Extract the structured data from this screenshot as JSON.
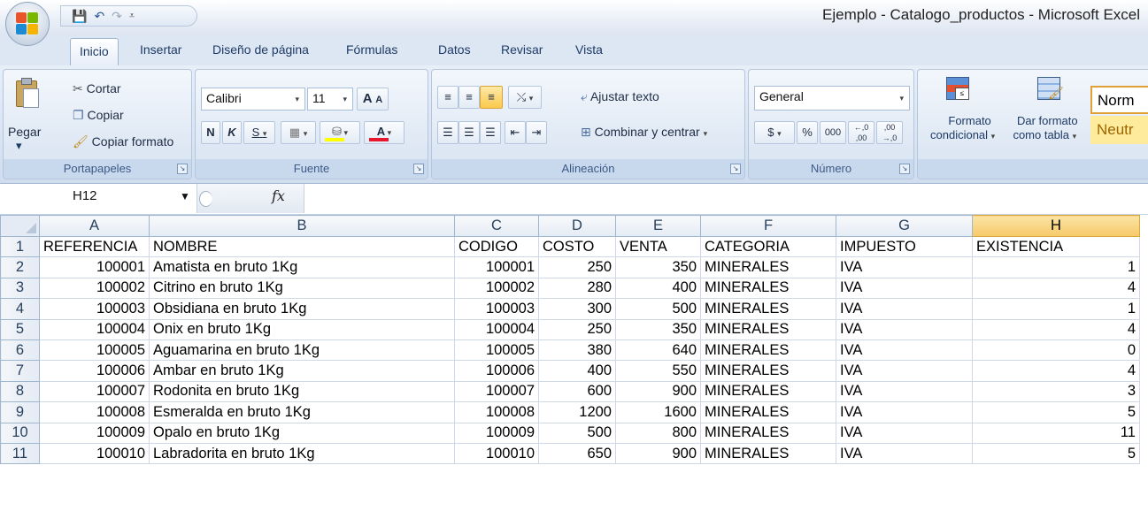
{
  "window": {
    "title": "Ejemplo - Catalogo_productos - Microsoft Excel",
    "quick_access": {
      "save": "💾",
      "undo": "↶",
      "redo": "↷",
      "customize": "⩡"
    }
  },
  "tabs": [
    "Inicio",
    "Insertar",
    "Diseño de página",
    "Fórmulas",
    "Datos",
    "Revisar",
    "Vista"
  ],
  "active_tab": "Inicio",
  "ribbon": {
    "clipboard": {
      "label": "Portapapeles",
      "paste": "Pegar",
      "cut": "Cortar",
      "copy": "Copiar",
      "format_painter": "Copiar formato"
    },
    "font": {
      "label": "Fuente",
      "font_name": "Calibri",
      "font_size": "11",
      "grow": "A",
      "shrink": "A",
      "bold": "N",
      "italic": "K",
      "underline": "S",
      "font_color": "A"
    },
    "alignment": {
      "label": "Alineación",
      "wrap_text": "Ajustar texto",
      "merge_center": "Combinar y centrar"
    },
    "number": {
      "label": "Número",
      "format": "General",
      "currency": "$",
      "percent": "%",
      "thousands": "000",
      "inc_decimal": "←,0 ,00",
      "dec_decimal": ",00 →,0"
    },
    "styles": {
      "conditional_1": "Formato",
      "conditional_2": "condicional",
      "as_table_1": "Dar formato",
      "as_table_2": "como tabla",
      "style_normal": "Norm",
      "style_neutral": "Neutr"
    }
  },
  "formula_bar": {
    "name_box": "H12",
    "fx": "fx",
    "content": ""
  },
  "sheet": {
    "columns": [
      "A",
      "B",
      "C",
      "D",
      "E",
      "F",
      "G",
      "H"
    ],
    "selected_column": "H",
    "headers": [
      "REFERENCIA",
      "NOMBRE",
      "CODIGO",
      "COSTO",
      "VENTA",
      "CATEGORIA",
      "IMPUESTO",
      "EXISTENCIA"
    ],
    "rows": [
      [
        "100001",
        "Amatista en bruto 1Kg",
        "100001",
        "250",
        "350",
        "MINERALES",
        "IVA",
        "1"
      ],
      [
        "100002",
        "Citrino en bruto 1Kg",
        "100002",
        "280",
        "400",
        "MINERALES",
        "IVA",
        "4"
      ],
      [
        "100003",
        "Obsidiana en bruto 1Kg",
        "100003",
        "300",
        "500",
        "MINERALES",
        "IVA",
        "1"
      ],
      [
        "100004",
        "Onix en bruto 1Kg",
        "100004",
        "250",
        "350",
        "MINERALES",
        "IVA",
        "4"
      ],
      [
        "100005",
        "Aguamarina en bruto 1Kg",
        "100005",
        "380",
        "640",
        "MINERALES",
        "IVA",
        "0"
      ],
      [
        "100006",
        "Ambar en bruto 1Kg",
        "100006",
        "400",
        "550",
        "MINERALES",
        "IVA",
        "4"
      ],
      [
        "100007",
        "Rodonita en bruto 1Kg",
        "100007",
        "600",
        "900",
        "MINERALES",
        "IVA",
        "3"
      ],
      [
        "100008",
        "Esmeralda en bruto 1Kg",
        "100008",
        "1200",
        "1600",
        "MINERALES",
        "IVA",
        "5"
      ],
      [
        "100009",
        "Opalo en bruto 1Kg",
        "100009",
        "500",
        "800",
        "MINERALES",
        "IVA",
        "11"
      ],
      [
        "100010",
        "Labradorita en bruto 1Kg",
        "100010",
        "650",
        "900",
        "MINERALES",
        "IVA",
        "5"
      ]
    ]
  }
}
